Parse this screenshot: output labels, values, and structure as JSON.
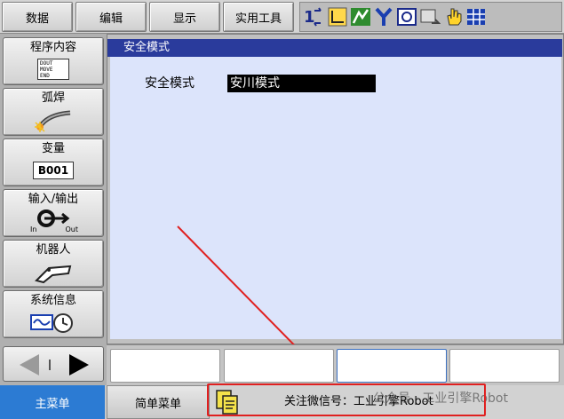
{
  "top_menu": [
    "数据",
    "编辑",
    "显示",
    "实用工具"
  ],
  "status_icons": [
    "s-axis-icon",
    "coordinate-icon",
    "tool-icon",
    "y-icon",
    "camera-icon",
    "screen-icon",
    "hand-icon",
    "grid-icon"
  ],
  "sidebar": {
    "items": [
      {
        "label": "程序内容",
        "icon": "program-doc-icon",
        "icon_lines": [
          "DOUT",
          "MOVE",
          "END"
        ]
      },
      {
        "label": "弧焊",
        "icon": "arc-weld-icon"
      },
      {
        "label": "变量",
        "icon": "variable-icon",
        "icon_text": "B001"
      },
      {
        "label": "输入/输出",
        "icon": "io-icon",
        "icon_in": "In",
        "icon_out": "Out"
      },
      {
        "label": "机器人",
        "icon": "robot-arm-icon"
      },
      {
        "label": "系统信息",
        "icon": "system-info-icon"
      }
    ]
  },
  "main": {
    "title": "安全模式",
    "field_label": "安全模式",
    "field_value": "安川模式"
  },
  "bottom": {
    "main_menu": "主菜单",
    "simple_menu": "简单菜单",
    "message": "关注微信号：工业引擎Robot",
    "watermark": "公众号 · 工业引擎Robot"
  },
  "colors": {
    "title_bar": "#2a3b9c",
    "content_bg": "#dce4fb",
    "main_menu_bg": "#2c7bd3",
    "annotation": "#e02020"
  }
}
